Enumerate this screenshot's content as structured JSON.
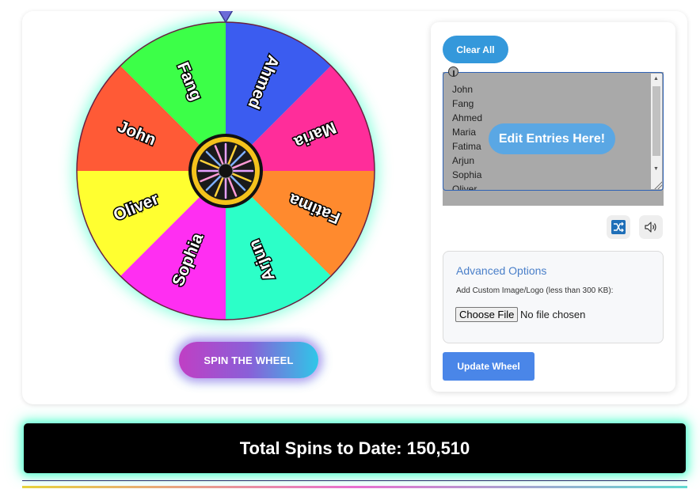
{
  "wheel": {
    "pointer_color": "#6b6bd8",
    "segments": [
      {
        "label": "Ahmed",
        "color": "#3b5cf0"
      },
      {
        "label": "Maria",
        "color": "#ff2d9a"
      },
      {
        "label": "Fatima",
        "color": "#ff8a2e"
      },
      {
        "label": "Arjun",
        "color": "#2cffc8"
      },
      {
        "label": "Sophia",
        "color": "#ff2ef2"
      },
      {
        "label": "Oliver",
        "color": "#ffff30"
      },
      {
        "label": "John",
        "color": "#ff5a36"
      },
      {
        "label": "Fang",
        "color": "#3cff48"
      }
    ],
    "spin_button_label": "SPIN THE WHEEL"
  },
  "side_panel": {
    "clear_button_label": "Clear All",
    "entries": [
      "John",
      "Fang",
      "Ahmed",
      "Maria",
      "Fatima",
      "Arjun",
      "Sophia",
      "Oliver"
    ],
    "edit_hint": "Edit Entries Here!",
    "shuffle_icon": "shuffle-icon",
    "sound_icon": "speaker-icon",
    "advanced": {
      "title": "Advanced Options",
      "custom_image_label": "Add Custom Image/Logo (less than 300 KB):",
      "choose_file_label": "Choose File",
      "file_status": "No file chosen"
    },
    "update_button_label": "Update Wheel"
  },
  "banner": {
    "text": "Total Spins to Date: 150,510"
  },
  "colors": {
    "accent_blue": "#3498db",
    "update_blue": "#4a86e8",
    "glow": "#3cffc8"
  }
}
